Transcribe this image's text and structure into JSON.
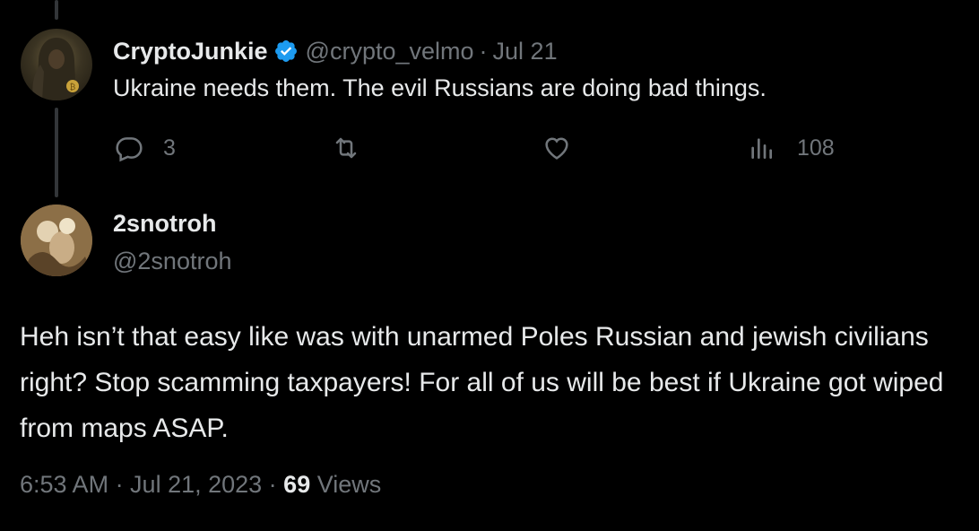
{
  "parent_tweet": {
    "display_name": "CryptoJunkie",
    "verified": true,
    "handle": "@crypto_velmo",
    "separator": "·",
    "date": "Jul 21",
    "text": "Ukraine needs them. The evil Russians are doing bad things.",
    "actions": {
      "reply_count": "3",
      "retweet_count": "",
      "like_count": "",
      "views_count": "108"
    }
  },
  "main_tweet": {
    "display_name": "2snotroh",
    "handle": "@2snotroh",
    "text": "Heh isn’t that easy like was with unarmed Poles Russian and jewish civilians right? Stop scamming taxpayers! For all of us will be best if Ukraine got wiped from maps ASAP.",
    "timestamp": "6:53 AM · Jul 21, 2023 · ",
    "views_number": "69",
    "views_label": " Views"
  },
  "colors": {
    "background": "#000000",
    "primary_text": "#e7e9ea",
    "secondary_text": "#71767b",
    "verified_blue": "#1d9bf0",
    "thread_line": "#333639"
  }
}
